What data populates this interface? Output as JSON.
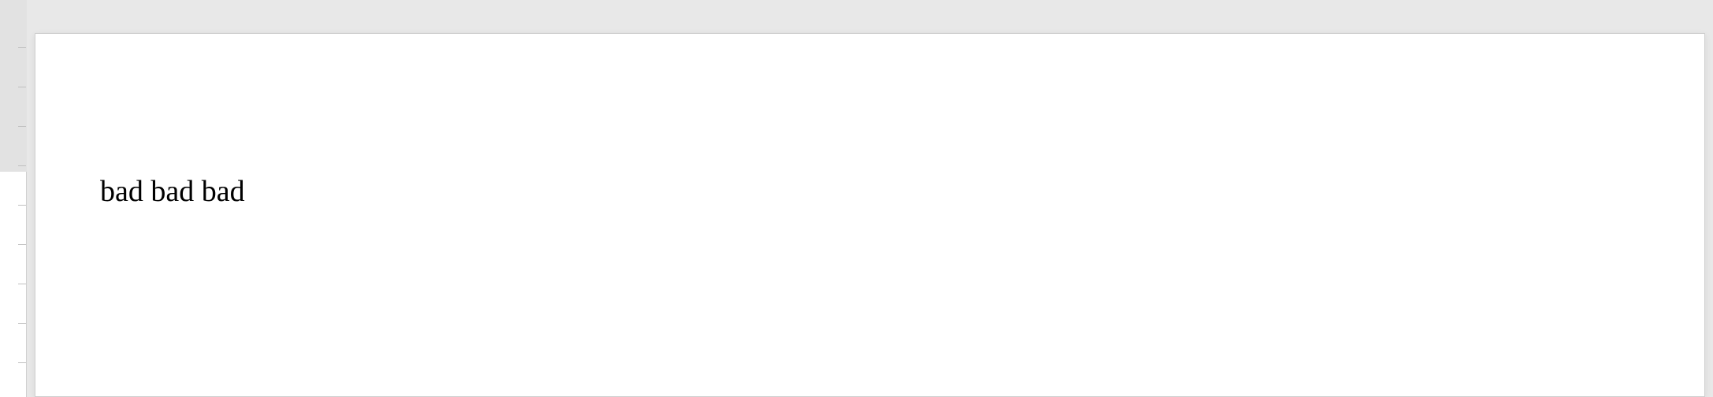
{
  "document": {
    "body_text": "bad bad bad"
  }
}
